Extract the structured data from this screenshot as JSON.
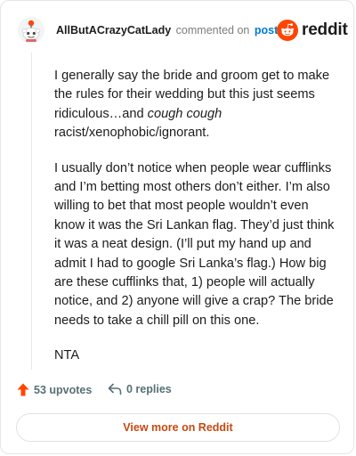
{
  "header": {
    "username": "AllButACrazyCatLady",
    "action_text": "commented on",
    "post_link": "post",
    "brand": "reddit"
  },
  "comment": {
    "paragraphs": [
      {
        "before_italic": "I generally say the bride and groom get to make the rules for their wedding but this just seems ridiculous…and ",
        "italic": "cough cough",
        "after_italic": " racist/xenophobic/ignorant."
      },
      {
        "text": "I usually don’t notice when people wear cufflinks and I’m betting most others don’t either. I’m also willing to bet that most people wouldn’t even know it was the Sri Lankan flag. They’d just think it was a neat design. (I’ll put my hand up and admit I had to google Sri Lanka’s flag.) How big are these cufflinks that, 1) people will actually notice, and 2) anyone will give a crap? The bride needs to take a chill pill on this one."
      },
      {
        "text": "NTA"
      }
    ]
  },
  "footer": {
    "upvotes": "53 upvotes",
    "replies": "0 replies",
    "view_button": "View more on Reddit"
  },
  "colors": {
    "upvote": "#ff4500",
    "link": "#0079d3",
    "button_text": "#c44a12",
    "meta_text": "#576f76"
  },
  "icons": {
    "avatar": "snoo-avatar-icon",
    "logo": "reddit-logo-icon",
    "upvote": "upvote-arrow-icon",
    "reply": "reply-arrow-icon"
  }
}
